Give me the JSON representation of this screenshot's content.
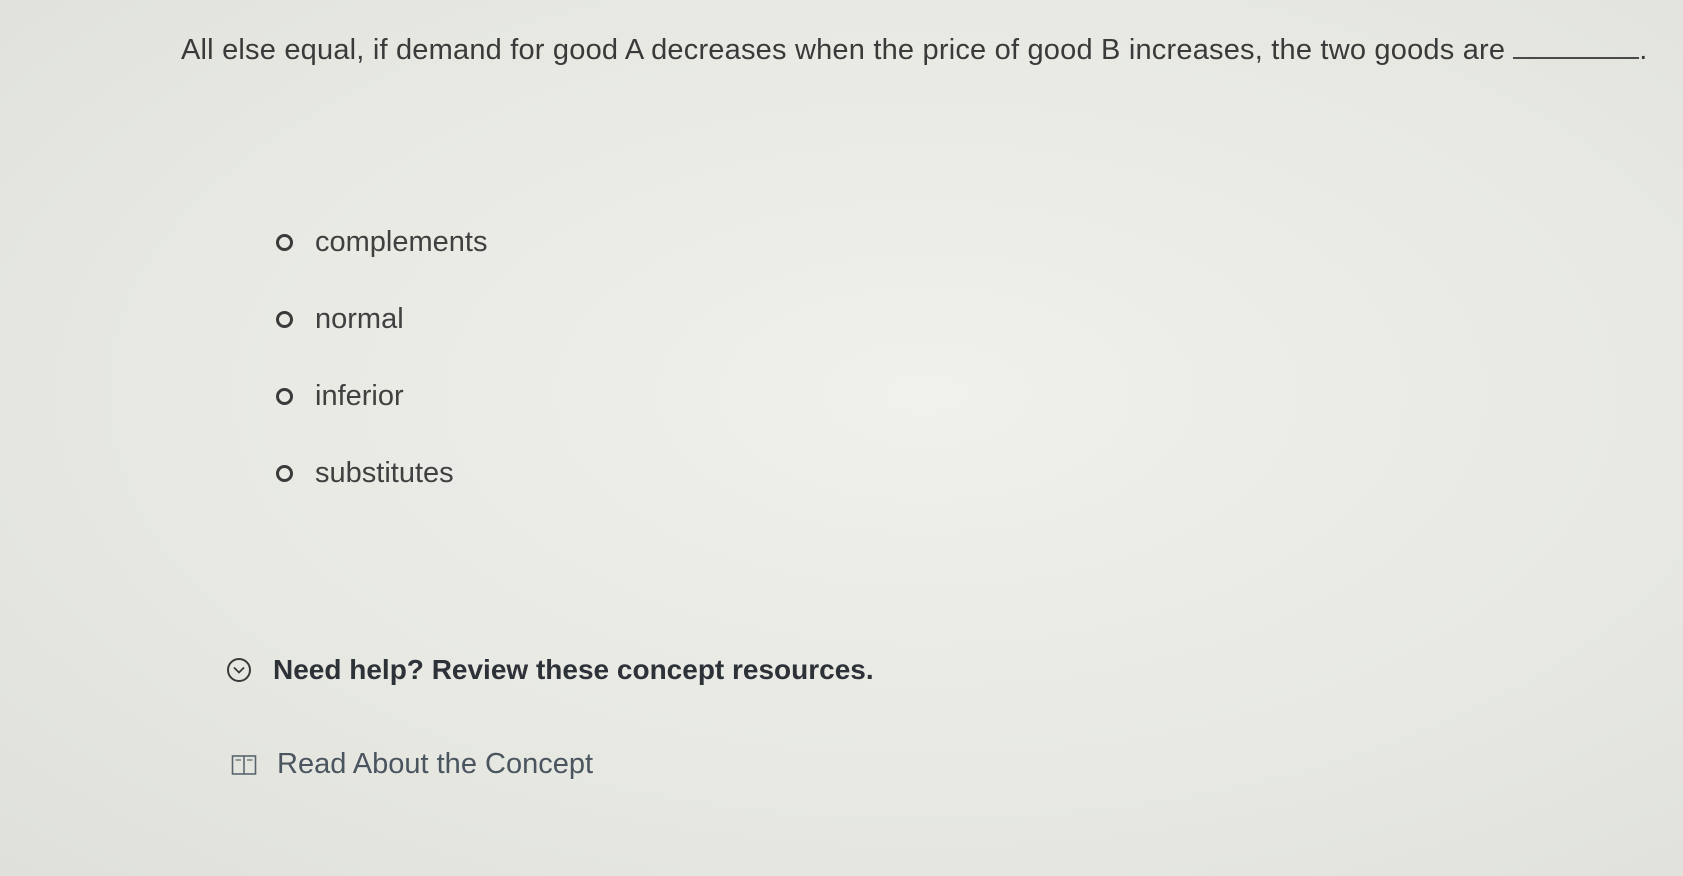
{
  "question": {
    "text": "All else equal, if demand for good A decreases when the price of good B increases, the two goods are",
    "end": "."
  },
  "options": [
    {
      "label": "complements",
      "selected": false
    },
    {
      "label": "normal",
      "selected": false
    },
    {
      "label": "inferior",
      "selected": false
    },
    {
      "label": "substitutes",
      "selected": false
    }
  ],
  "help": {
    "text": "Need help? Review these concept resources.",
    "icon": "chevron-down-circle-icon"
  },
  "resources": [
    {
      "label": "Read About the Concept",
      "icon": "book-icon"
    }
  ],
  "colors": {
    "background": "#e8e9e3",
    "text": "#3a3a3a",
    "help_text": "#2d3138",
    "resource_text": "#4a5560"
  }
}
